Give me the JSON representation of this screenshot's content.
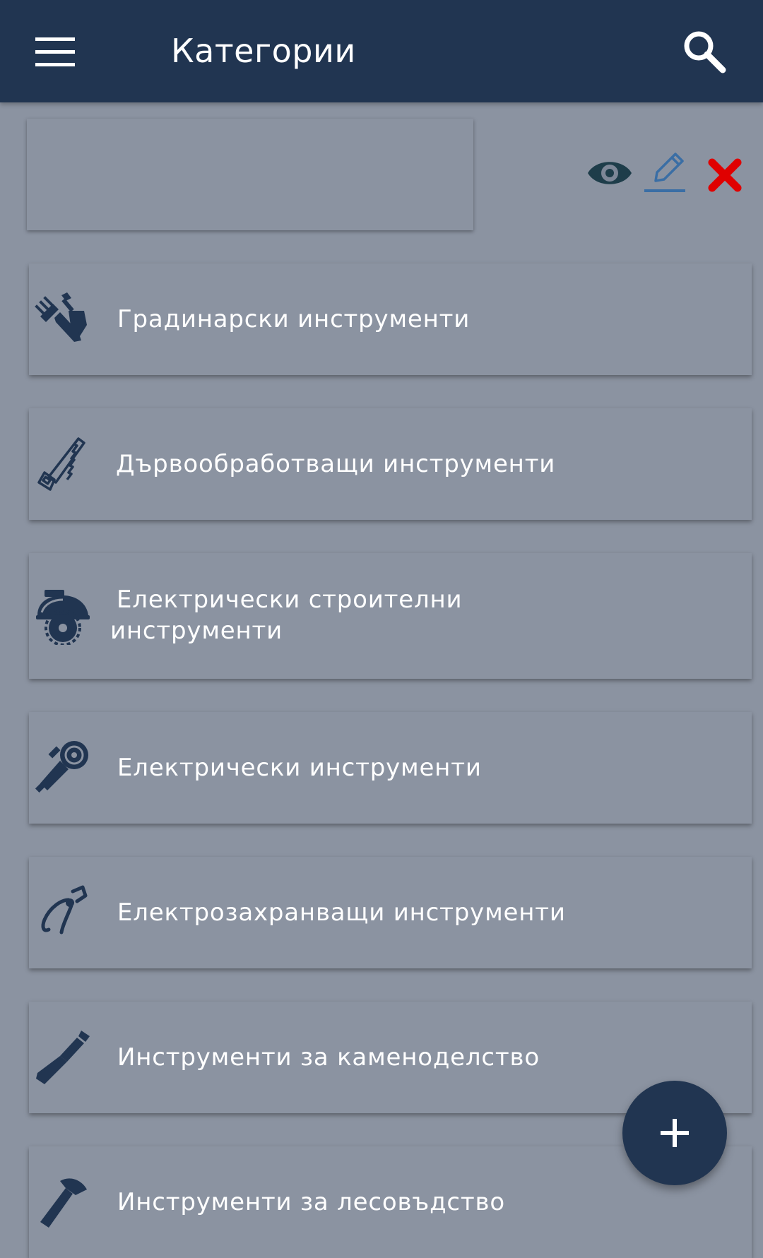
{
  "header": {
    "title": "Категории",
    "menu_icon": "hamburger-menu-icon",
    "search_icon": "search-icon"
  },
  "swipe_actions": {
    "view_icon": "eye-icon",
    "edit_icon": "pencil-icon",
    "delete_icon": "delete-x-icon",
    "colors": {
      "eye": "#1e3d4a",
      "pencil": "#3a6ea5",
      "delete": "#e00000"
    }
  },
  "categories": [
    {
      "label": "Градинарски инструменти",
      "icon": "garden-tools-icon"
    },
    {
      "label": "Дървообработващи инструменти",
      "icon": "hand-saw-icon"
    },
    {
      "label_line1": "Електрически строителни",
      "label_line2": "инструменти",
      "icon": "circular-saw-icon"
    },
    {
      "label": "Електрически инструменти",
      "icon": "angle-grinder-icon"
    },
    {
      "label": "Електрозахранващи инструменти",
      "icon": "pliers-icon"
    },
    {
      "label": "Инструменти за каменоделство",
      "icon": "chisel-icon"
    },
    {
      "label": "Инструменти за лесовъдство",
      "icon": "axe-icon"
    }
  ],
  "fab": {
    "icon": "plus-icon"
  },
  "colors": {
    "appbar": "#213551",
    "background": "#8b93a1",
    "icon": "#213551",
    "text": "#ffffff"
  }
}
